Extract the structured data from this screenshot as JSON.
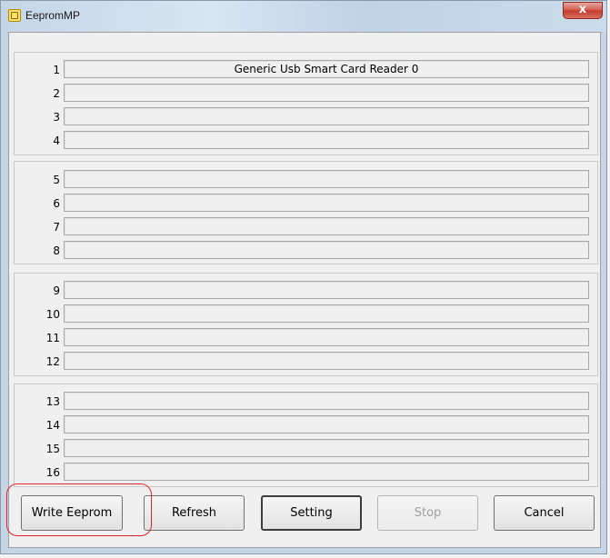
{
  "window": {
    "title": "EepromMP",
    "close_glyph": "x",
    "icon": "chip-icon"
  },
  "groups": [
    {
      "rows": [
        {
          "num": "1",
          "value": "Generic Usb Smart Card Reader 0"
        },
        {
          "num": "2",
          "value": ""
        },
        {
          "num": "3",
          "value": ""
        },
        {
          "num": "4",
          "value": ""
        }
      ]
    },
    {
      "rows": [
        {
          "num": "5",
          "value": ""
        },
        {
          "num": "6",
          "value": ""
        },
        {
          "num": "7",
          "value": ""
        },
        {
          "num": "8",
          "value": ""
        }
      ]
    },
    {
      "rows": [
        {
          "num": "9",
          "value": ""
        },
        {
          "num": "10",
          "value": ""
        },
        {
          "num": "11",
          "value": ""
        },
        {
          "num": "12",
          "value": ""
        }
      ]
    },
    {
      "rows": [
        {
          "num": "13",
          "value": ""
        },
        {
          "num": "14",
          "value": ""
        },
        {
          "num": "15",
          "value": ""
        },
        {
          "num": "16",
          "value": ""
        }
      ]
    }
  ],
  "buttons": {
    "write_eeprom": "Write Eeprom",
    "refresh": "Refresh",
    "setting": "Setting",
    "stop": "Stop",
    "cancel": "Cancel"
  },
  "colors": {
    "highlight": "#e0242a",
    "close_button": "#c23a2c"
  }
}
